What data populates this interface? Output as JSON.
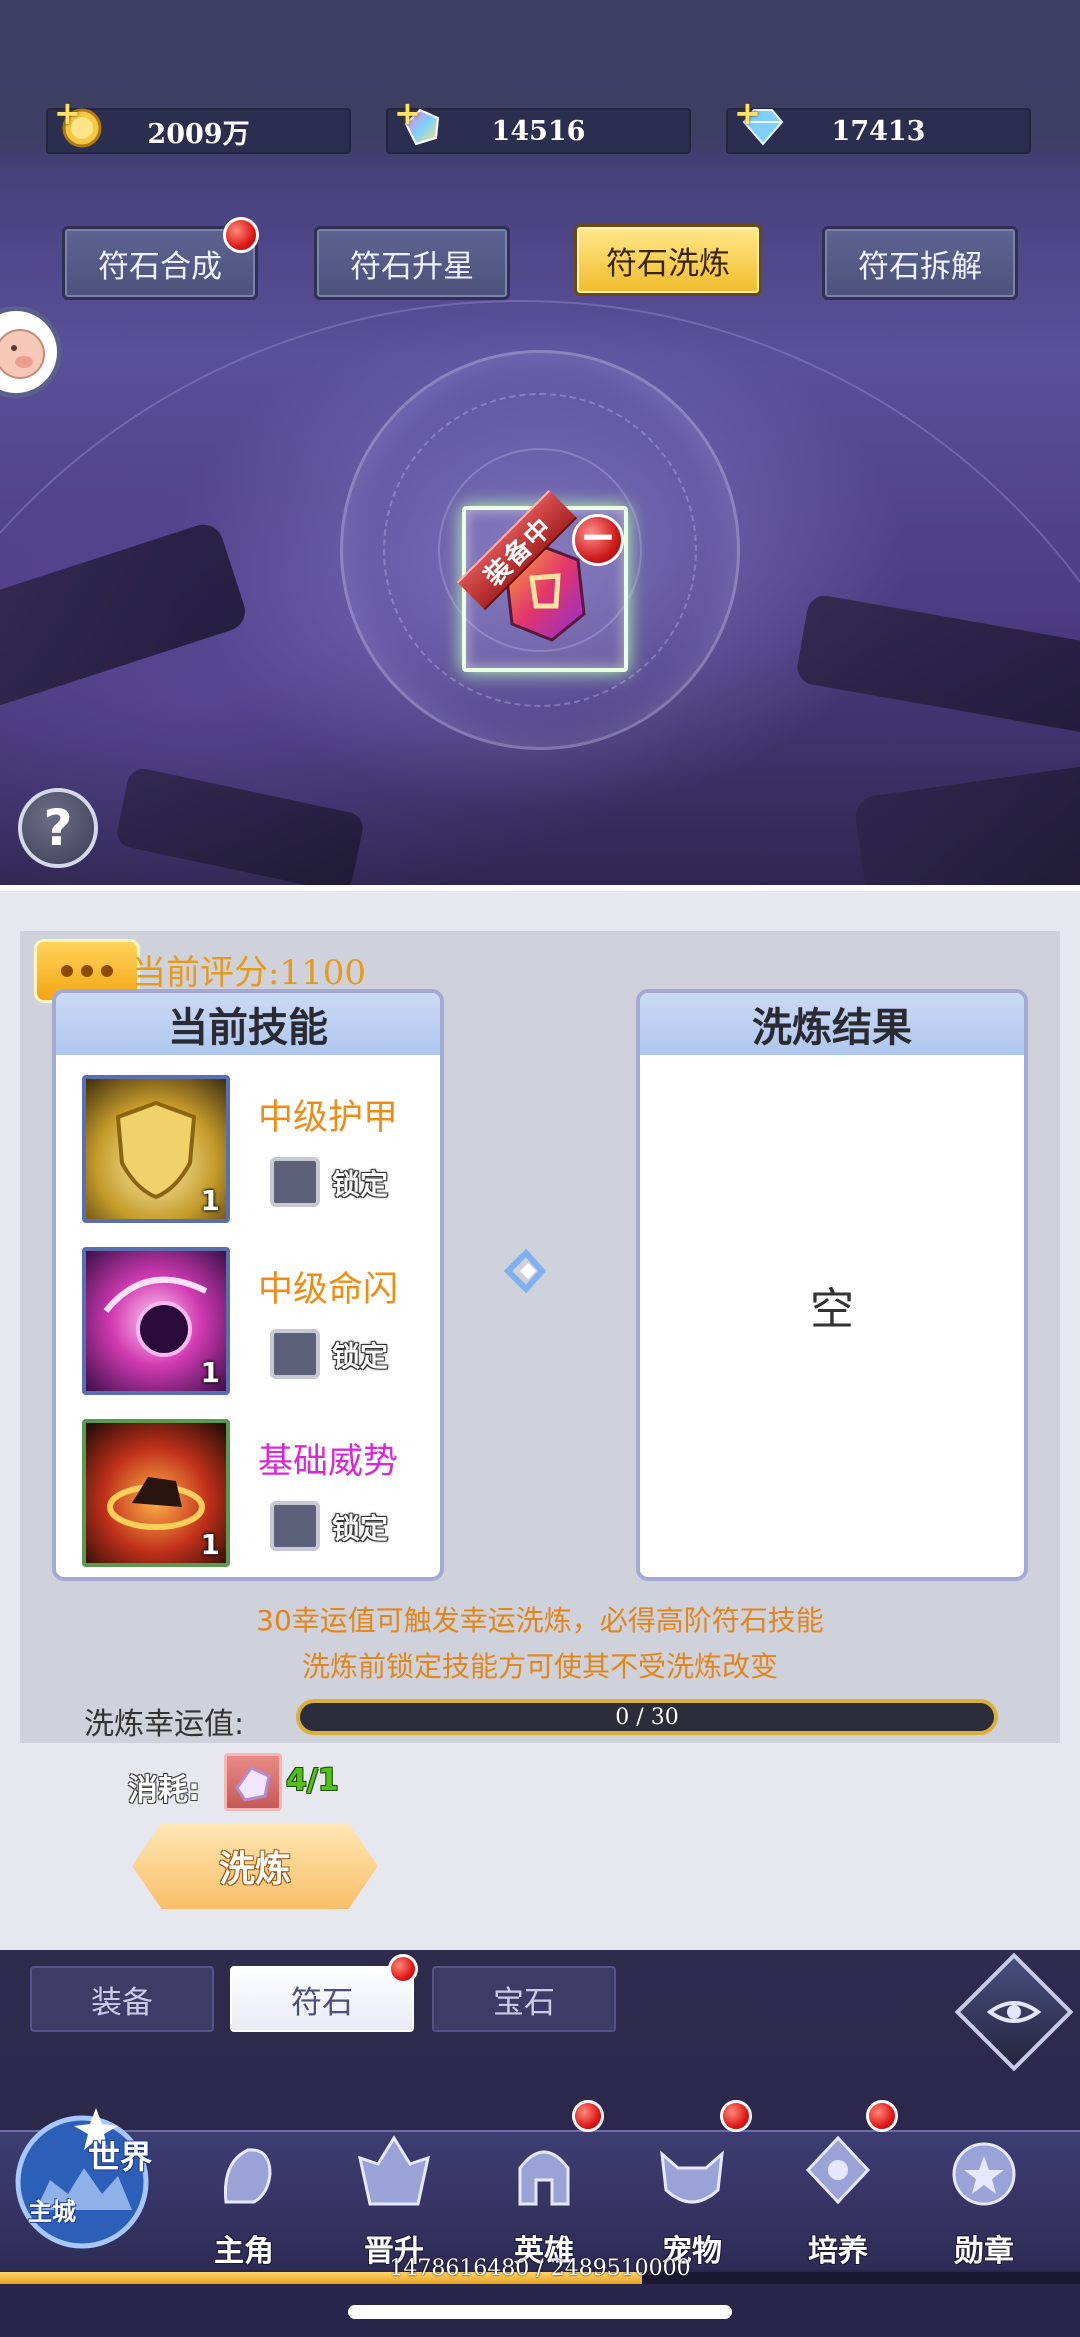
{
  "currencies": [
    {
      "id": "gold",
      "value": "2009万",
      "icon": "gold-coin-icon"
    },
    {
      "id": "crystal",
      "value": "14516",
      "icon": "rainbow-crystal-icon"
    },
    {
      "id": "diamond",
      "value": "17413",
      "icon": "blue-diamond-icon"
    }
  ],
  "rune_tabs": [
    {
      "label": "符石合成",
      "active": false,
      "badge": true
    },
    {
      "label": "符石升星",
      "active": false,
      "badge": false
    },
    {
      "label": "符石洗炼",
      "active": true,
      "badge": false
    },
    {
      "label": "符石拆解",
      "active": false,
      "badge": false
    }
  ],
  "equipped_rune": {
    "ribbon": "装备中"
  },
  "help": {
    "glyph": "?"
  },
  "panel": {
    "score": "当前评分:1100",
    "current_title": "当前技能",
    "result_title": "洗炼结果",
    "result_empty": "空",
    "skills": [
      {
        "name": "中级护甲",
        "level": "1",
        "lock_label": "锁定",
        "color": "#f08c14",
        "icon": "golden-shield-icon"
      },
      {
        "name": "中级命闪",
        "level": "1",
        "lock_label": "锁定",
        "color": "#f08c14",
        "icon": "pink-vortex-icon"
      },
      {
        "name": "基础威势",
        "level": "1",
        "lock_label": "锁定",
        "color": "#d62ad6",
        "icon": "fire-beast-icon"
      }
    ],
    "hint_line1": "30幸运值可触发幸运洗炼，必得高阶符石技能",
    "hint_line2": "洗炼前锁定技能方可使其不受洗炼改变",
    "luck_label": "洗炼幸运值:",
    "luck_text": "0 / 30",
    "luck_fraction": 0,
    "cost_label": "消耗:",
    "cost_value": "4/1",
    "refine_button": "洗炼"
  },
  "bag_tabs": [
    {
      "label": "装备",
      "active": false,
      "badge": false
    },
    {
      "label": "符石",
      "active": true,
      "badge": true
    },
    {
      "label": "宝石",
      "active": false,
      "badge": false
    }
  ],
  "nav": {
    "world_label": "世界",
    "main_city_label": "主城",
    "items": [
      {
        "label": "主角",
        "icon": "hero-profile-icon",
        "badge": false
      },
      {
        "label": "晋升",
        "icon": "promotion-crest-icon",
        "badge": false
      },
      {
        "label": "英雄",
        "icon": "helmet-icon",
        "badge": true
      },
      {
        "label": "宠物",
        "icon": "pet-beast-icon",
        "badge": true
      },
      {
        "label": "培养",
        "icon": "training-emblem-icon",
        "badge": true
      },
      {
        "label": "勋章",
        "icon": "medal-icon",
        "badge": false
      }
    ],
    "exp_text": "1478616480 / 2489510000",
    "exp_fraction": 0.594
  }
}
